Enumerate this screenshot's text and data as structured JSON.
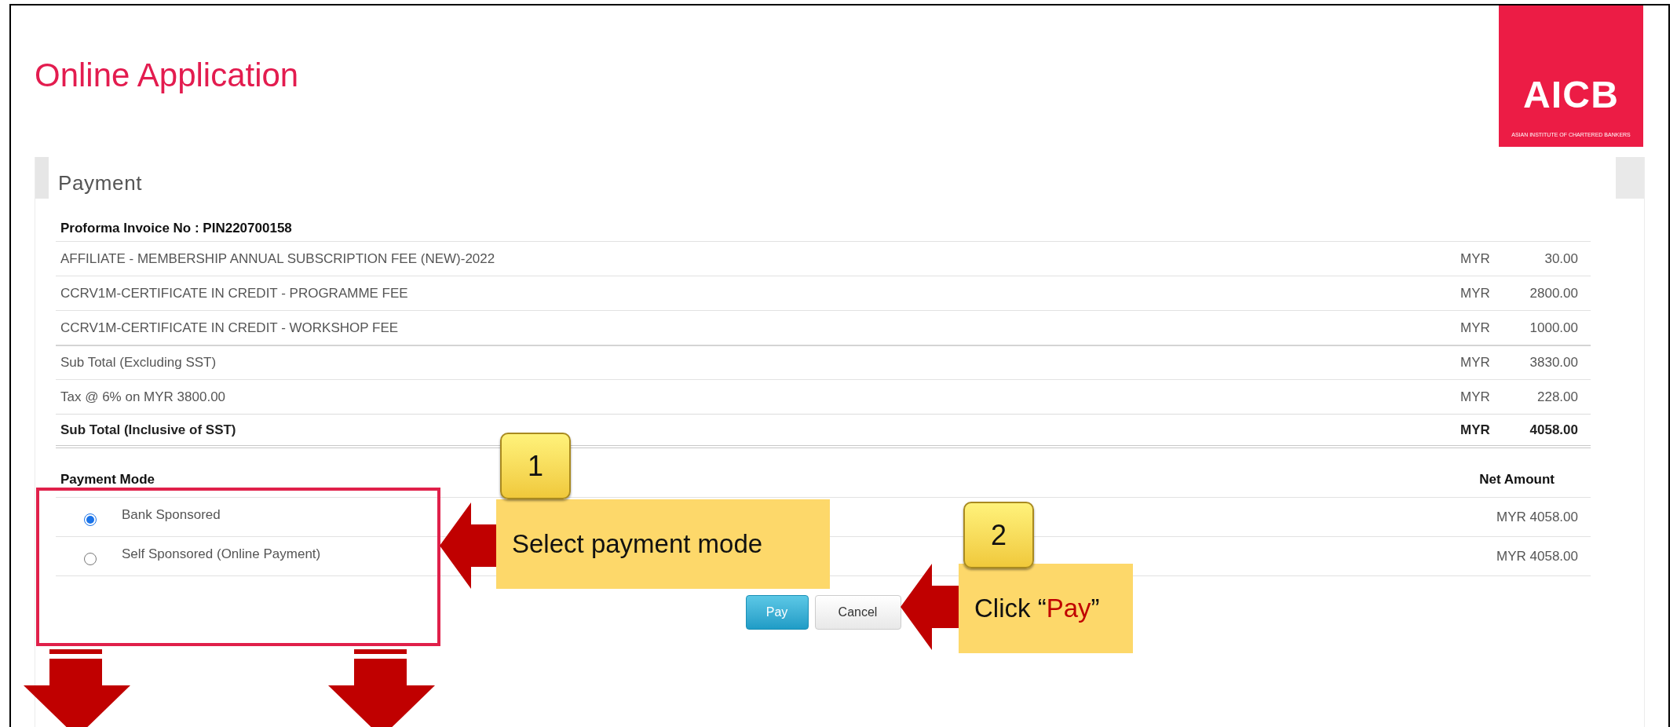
{
  "page": {
    "title": "Online Application",
    "logo": {
      "mark": "AICB",
      "tagline": "ASIAN INSTITUTE OF CHARTERED BANKERS"
    }
  },
  "payment": {
    "heading": "Payment",
    "invoice": "Proforma Invoice No : PIN220700158",
    "items": [
      {
        "kind": "item",
        "description": "AFFILIATE - MEMBERSHIP ANNUAL SUBSCRIPTION FEE (NEW)-2022",
        "currency": "MYR",
        "amount": "30.00"
      },
      {
        "kind": "item",
        "description": "CCRV1M-CERTIFICATE IN CREDIT - PROGRAMME FEE",
        "currency": "MYR",
        "amount": "2800.00"
      },
      {
        "kind": "item",
        "description": "CCRV1M-CERTIFICATE IN CREDIT - WORKSHOP FEE",
        "currency": "MYR",
        "amount": "1000.00"
      },
      {
        "kind": "subtotal",
        "description": "Sub Total (Excluding SST)",
        "currency": "MYR",
        "amount": "3830.00"
      },
      {
        "kind": "item",
        "description": "Tax @ 6% on MYR 3800.00",
        "currency": "MYR",
        "amount": "228.00"
      },
      {
        "kind": "total",
        "description": "Sub Total (Inclusive of SST)",
        "currency": "MYR",
        "amount": "4058.00"
      }
    ],
    "mode_header": "Payment Mode",
    "amount_header": "Net Amount",
    "modes": [
      {
        "label": "Bank Sponsored",
        "amount": "MYR 4058.00",
        "selected": true
      },
      {
        "label": "Self Sponsored (Online Payment)",
        "amount": "MYR 4058.00",
        "selected": false
      }
    ],
    "buttons": [
      {
        "label": "Pay",
        "kind": "primary"
      },
      {
        "label": "Cancel",
        "kind": "default"
      }
    ]
  },
  "annotations": [
    {
      "number": "1",
      "parts": [
        {
          "text": "Select payment mode",
          "highlight": false
        }
      ]
    },
    {
      "number": "2",
      "parts": [
        {
          "text": "Click “",
          "highlight": false
        },
        {
          "text": "Pay",
          "highlight": true
        },
        {
          "text": "”",
          "highlight": false
        }
      ]
    }
  ]
}
